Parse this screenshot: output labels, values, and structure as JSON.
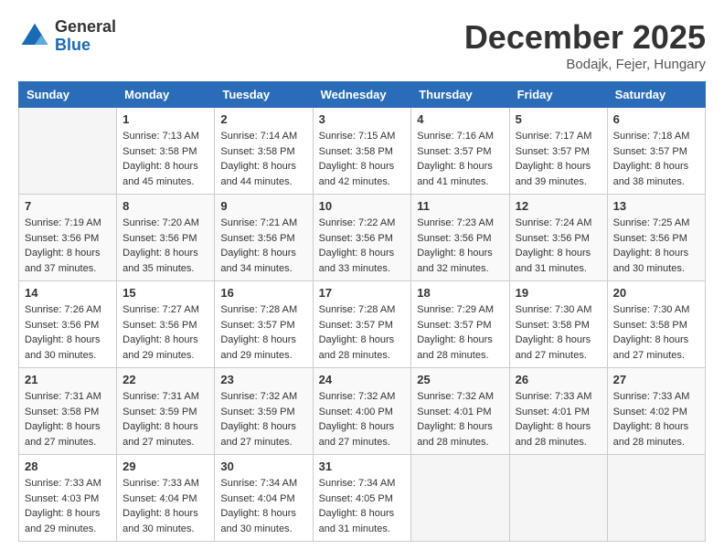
{
  "header": {
    "logo_general": "General",
    "logo_blue": "Blue",
    "month_title": "December 2025",
    "location": "Bodajk, Fejer, Hungary"
  },
  "days_of_week": [
    "Sunday",
    "Monday",
    "Tuesday",
    "Wednesday",
    "Thursday",
    "Friday",
    "Saturday"
  ],
  "weeks": [
    [
      {
        "day": "",
        "info": []
      },
      {
        "day": "1",
        "info": [
          "Sunrise: 7:13 AM",
          "Sunset: 3:58 PM",
          "Daylight: 8 hours",
          "and 45 minutes."
        ]
      },
      {
        "day": "2",
        "info": [
          "Sunrise: 7:14 AM",
          "Sunset: 3:58 PM",
          "Daylight: 8 hours",
          "and 44 minutes."
        ]
      },
      {
        "day": "3",
        "info": [
          "Sunrise: 7:15 AM",
          "Sunset: 3:58 PM",
          "Daylight: 8 hours",
          "and 42 minutes."
        ]
      },
      {
        "day": "4",
        "info": [
          "Sunrise: 7:16 AM",
          "Sunset: 3:57 PM",
          "Daylight: 8 hours",
          "and 41 minutes."
        ]
      },
      {
        "day": "5",
        "info": [
          "Sunrise: 7:17 AM",
          "Sunset: 3:57 PM",
          "Daylight: 8 hours",
          "and 39 minutes."
        ]
      },
      {
        "day": "6",
        "info": [
          "Sunrise: 7:18 AM",
          "Sunset: 3:57 PM",
          "Daylight: 8 hours",
          "and 38 minutes."
        ]
      }
    ],
    [
      {
        "day": "7",
        "info": [
          "Sunrise: 7:19 AM",
          "Sunset: 3:56 PM",
          "Daylight: 8 hours",
          "and 37 minutes."
        ]
      },
      {
        "day": "8",
        "info": [
          "Sunrise: 7:20 AM",
          "Sunset: 3:56 PM",
          "Daylight: 8 hours",
          "and 35 minutes."
        ]
      },
      {
        "day": "9",
        "info": [
          "Sunrise: 7:21 AM",
          "Sunset: 3:56 PM",
          "Daylight: 8 hours",
          "and 34 minutes."
        ]
      },
      {
        "day": "10",
        "info": [
          "Sunrise: 7:22 AM",
          "Sunset: 3:56 PM",
          "Daylight: 8 hours",
          "and 33 minutes."
        ]
      },
      {
        "day": "11",
        "info": [
          "Sunrise: 7:23 AM",
          "Sunset: 3:56 PM",
          "Daylight: 8 hours",
          "and 32 minutes."
        ]
      },
      {
        "day": "12",
        "info": [
          "Sunrise: 7:24 AM",
          "Sunset: 3:56 PM",
          "Daylight: 8 hours",
          "and 31 minutes."
        ]
      },
      {
        "day": "13",
        "info": [
          "Sunrise: 7:25 AM",
          "Sunset: 3:56 PM",
          "Daylight: 8 hours",
          "and 30 minutes."
        ]
      }
    ],
    [
      {
        "day": "14",
        "info": [
          "Sunrise: 7:26 AM",
          "Sunset: 3:56 PM",
          "Daylight: 8 hours",
          "and 30 minutes."
        ]
      },
      {
        "day": "15",
        "info": [
          "Sunrise: 7:27 AM",
          "Sunset: 3:56 PM",
          "Daylight: 8 hours",
          "and 29 minutes."
        ]
      },
      {
        "day": "16",
        "info": [
          "Sunrise: 7:28 AM",
          "Sunset: 3:57 PM",
          "Daylight: 8 hours",
          "and 29 minutes."
        ]
      },
      {
        "day": "17",
        "info": [
          "Sunrise: 7:28 AM",
          "Sunset: 3:57 PM",
          "Daylight: 8 hours",
          "and 28 minutes."
        ]
      },
      {
        "day": "18",
        "info": [
          "Sunrise: 7:29 AM",
          "Sunset: 3:57 PM",
          "Daylight: 8 hours",
          "and 28 minutes."
        ]
      },
      {
        "day": "19",
        "info": [
          "Sunrise: 7:30 AM",
          "Sunset: 3:58 PM",
          "Daylight: 8 hours",
          "and 27 minutes."
        ]
      },
      {
        "day": "20",
        "info": [
          "Sunrise: 7:30 AM",
          "Sunset: 3:58 PM",
          "Daylight: 8 hours",
          "and 27 minutes."
        ]
      }
    ],
    [
      {
        "day": "21",
        "info": [
          "Sunrise: 7:31 AM",
          "Sunset: 3:58 PM",
          "Daylight: 8 hours",
          "and 27 minutes."
        ]
      },
      {
        "day": "22",
        "info": [
          "Sunrise: 7:31 AM",
          "Sunset: 3:59 PM",
          "Daylight: 8 hours",
          "and 27 minutes."
        ]
      },
      {
        "day": "23",
        "info": [
          "Sunrise: 7:32 AM",
          "Sunset: 3:59 PM",
          "Daylight: 8 hours",
          "and 27 minutes."
        ]
      },
      {
        "day": "24",
        "info": [
          "Sunrise: 7:32 AM",
          "Sunset: 4:00 PM",
          "Daylight: 8 hours",
          "and 27 minutes."
        ]
      },
      {
        "day": "25",
        "info": [
          "Sunrise: 7:32 AM",
          "Sunset: 4:01 PM",
          "Daylight: 8 hours",
          "and 28 minutes."
        ]
      },
      {
        "day": "26",
        "info": [
          "Sunrise: 7:33 AM",
          "Sunset: 4:01 PM",
          "Daylight: 8 hours",
          "and 28 minutes."
        ]
      },
      {
        "day": "27",
        "info": [
          "Sunrise: 7:33 AM",
          "Sunset: 4:02 PM",
          "Daylight: 8 hours",
          "and 28 minutes."
        ]
      }
    ],
    [
      {
        "day": "28",
        "info": [
          "Sunrise: 7:33 AM",
          "Sunset: 4:03 PM",
          "Daylight: 8 hours",
          "and 29 minutes."
        ]
      },
      {
        "day": "29",
        "info": [
          "Sunrise: 7:33 AM",
          "Sunset: 4:04 PM",
          "Daylight: 8 hours",
          "and 30 minutes."
        ]
      },
      {
        "day": "30",
        "info": [
          "Sunrise: 7:34 AM",
          "Sunset: 4:04 PM",
          "Daylight: 8 hours",
          "and 30 minutes."
        ]
      },
      {
        "day": "31",
        "info": [
          "Sunrise: 7:34 AM",
          "Sunset: 4:05 PM",
          "Daylight: 8 hours",
          "and 31 minutes."
        ]
      },
      {
        "day": "",
        "info": []
      },
      {
        "day": "",
        "info": []
      },
      {
        "day": "",
        "info": []
      }
    ]
  ]
}
